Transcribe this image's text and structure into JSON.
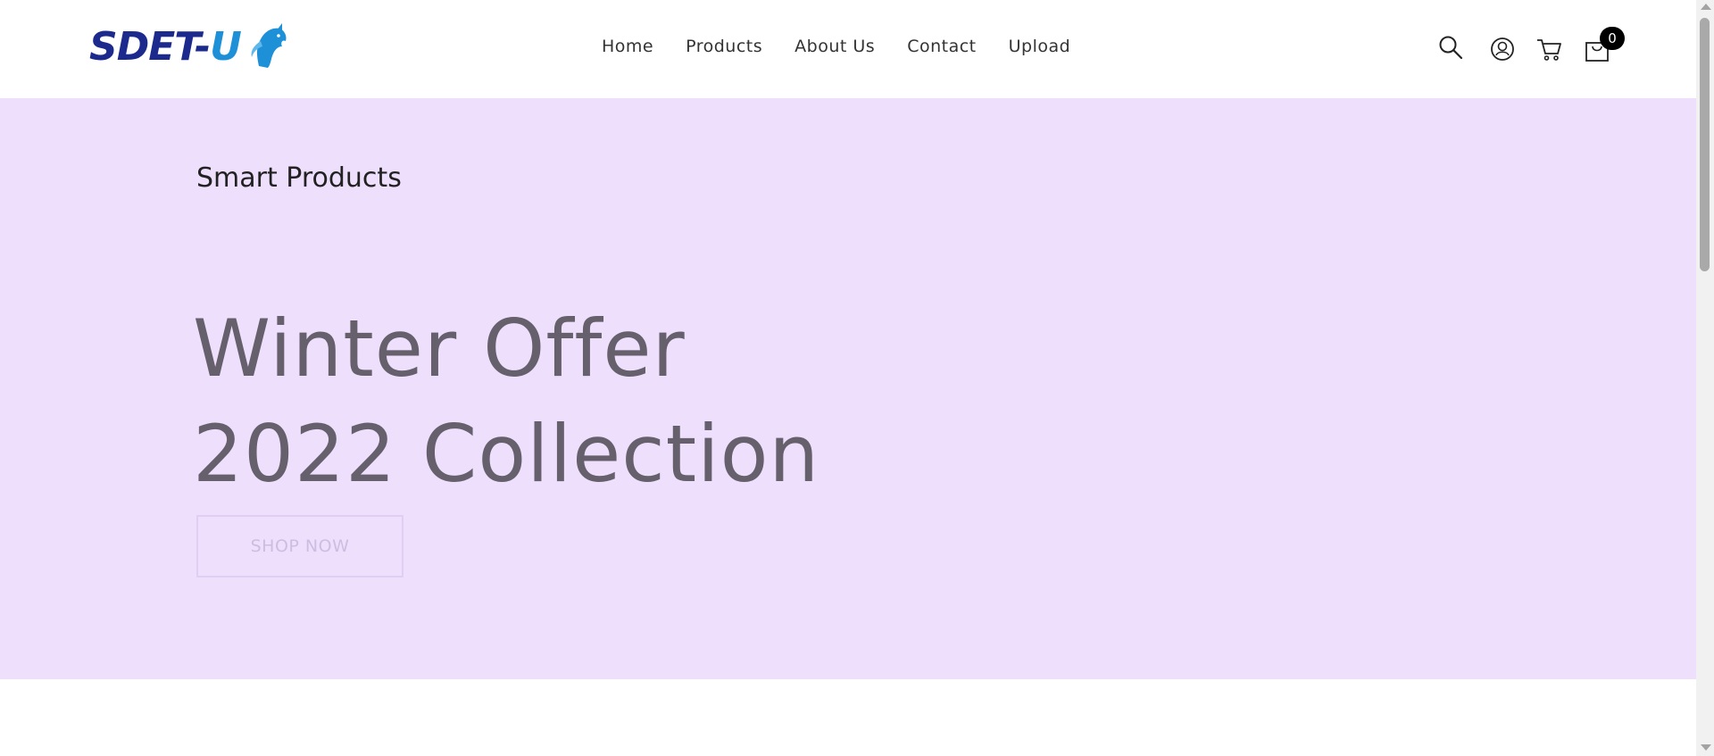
{
  "header": {
    "logo": {
      "text_main": "SDET-",
      "text_accent": "U",
      "icon": "horse-head-icon"
    },
    "nav": [
      {
        "label": "Home"
      },
      {
        "label": "Products"
      },
      {
        "label": "About Us"
      },
      {
        "label": "Contact"
      },
      {
        "label": "Upload"
      }
    ],
    "icons": [
      "search-icon",
      "user-icon",
      "cart-icon",
      "shopping-bag-icon"
    ],
    "bag_count": "0"
  },
  "hero": {
    "subtitle": "Smart Products",
    "headline_line1": "Winter Offer",
    "headline_line2": "2022 Collection",
    "button_label": "SHOP NOW",
    "background": "#eedffd",
    "headline_color": "#665f6c"
  },
  "colors": {
    "logo_dark": "#1b2a8c",
    "logo_accent": "#1e90d8",
    "badge": "#000000"
  }
}
